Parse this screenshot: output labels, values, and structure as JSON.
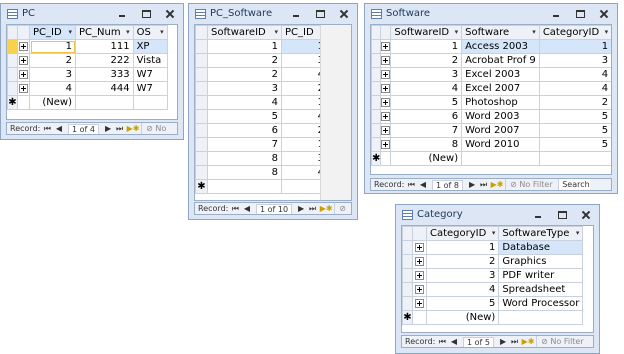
{
  "windows": {
    "pc": {
      "title": "PC",
      "columns": [
        "PC_ID",
        "PC_Num",
        "OS"
      ],
      "rows": [
        {
          "id": "1",
          "num": "111",
          "os": "XP"
        },
        {
          "id": "2",
          "num": "222",
          "os": "Vista"
        },
        {
          "id": "3",
          "num": "333",
          "os": "W7"
        },
        {
          "id": "4",
          "num": "444",
          "os": "W7"
        }
      ],
      "new_row": "(New)",
      "nav": {
        "record_label": "Record:",
        "position": "1 of 4",
        "filter": "No"
      }
    },
    "pc_software": {
      "title": "PC_Software",
      "columns": [
        "SoftwareID",
        "PC_ID"
      ],
      "rows": [
        {
          "software_id": "1",
          "pc_id": "1"
        },
        {
          "software_id": "2",
          "pc_id": "3"
        },
        {
          "software_id": "2",
          "pc_id": "4"
        },
        {
          "software_id": "3",
          "pc_id": "2"
        },
        {
          "software_id": "4",
          "pc_id": "1"
        },
        {
          "software_id": "5",
          "pc_id": "4"
        },
        {
          "software_id": "6",
          "pc_id": "2"
        },
        {
          "software_id": "7",
          "pc_id": "1"
        },
        {
          "software_id": "8",
          "pc_id": "3"
        },
        {
          "software_id": "8",
          "pc_id": "4"
        }
      ],
      "nav": {
        "record_label": "Record:",
        "position": "1 of 10"
      }
    },
    "software": {
      "title": "Software",
      "columns": [
        "SoftwareID",
        "Software",
        "CategoryID"
      ],
      "rows": [
        {
          "id": "1",
          "name": "Access 2003",
          "cat": "1"
        },
        {
          "id": "2",
          "name": "Acrobat Prof 9",
          "cat": "3"
        },
        {
          "id": "3",
          "name": "Excel 2003",
          "cat": "4"
        },
        {
          "id": "4",
          "name": "Excel 2007",
          "cat": "4"
        },
        {
          "id": "5",
          "name": "Photoshop",
          "cat": "2"
        },
        {
          "id": "6",
          "name": "Word 2003",
          "cat": "5"
        },
        {
          "id": "7",
          "name": "Word 2007",
          "cat": "5"
        },
        {
          "id": "8",
          "name": "Word 2010",
          "cat": "5"
        }
      ],
      "new_row": "(New)",
      "nav": {
        "record_label": "Record:",
        "position": "1 of 8",
        "filter": "No Filter",
        "search": "Search"
      }
    },
    "category": {
      "title": "Category",
      "columns": [
        "CategoryID",
        "SoftwareType"
      ],
      "rows": [
        {
          "id": "1",
          "type": "Database"
        },
        {
          "id": "2",
          "type": "Graphics"
        },
        {
          "id": "3",
          "type": "PDF writer"
        },
        {
          "id": "4",
          "type": "Spreadsheet"
        },
        {
          "id": "5",
          "type": "Word Processor"
        }
      ],
      "new_row": "(New)",
      "nav": {
        "record_label": "Record:",
        "position": "1 of 5",
        "filter": "No Filter"
      }
    }
  },
  "colors": {
    "window_bg": "#dce6f4",
    "selected_cell": "#d6e6fa",
    "current_record": "#f8d24a",
    "header_bg": "#eef2f8"
  }
}
